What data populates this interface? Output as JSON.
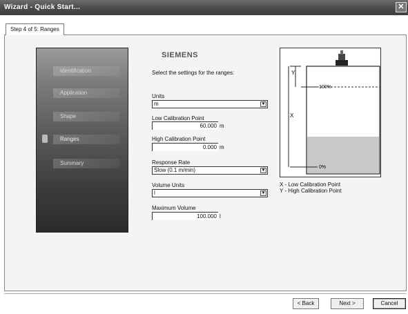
{
  "window": {
    "title": "Wizard - Quick Start..."
  },
  "tab": {
    "label": "Step 4 of 5: Ranges"
  },
  "nav": {
    "items": [
      "Identification",
      "Application",
      "Shape",
      "Ranges",
      "Summary"
    ]
  },
  "brand": "SIEMENS",
  "instruction": "Select the settings for the ranges:",
  "form": {
    "units": {
      "label": "Units",
      "value": "m"
    },
    "low_cal": {
      "label": "Low Calibration Point",
      "value": "60.000",
      "unit": "m"
    },
    "high_cal": {
      "label": "High Calibration Point",
      "value": "0.000",
      "unit": "m"
    },
    "response": {
      "label": "Response Rate",
      "value": "Slow (0.1 m/min)"
    },
    "vol_units": {
      "label": "Volume Units",
      "value": "l"
    },
    "max_vol": {
      "label": "Maximum Volume",
      "value": "100.000",
      "unit": "l"
    }
  },
  "diagram": {
    "y_label": "Y",
    "x_label": "X",
    "top_pct": "100%",
    "bottom_pct": "0%",
    "fill_color": "#c9c9c9"
  },
  "legend": {
    "x": "X - Low Calibration Point",
    "y": "Y - High Calibration Point"
  },
  "buttons": {
    "back": "< Back",
    "next": "Next >",
    "cancel": "Cancel"
  }
}
